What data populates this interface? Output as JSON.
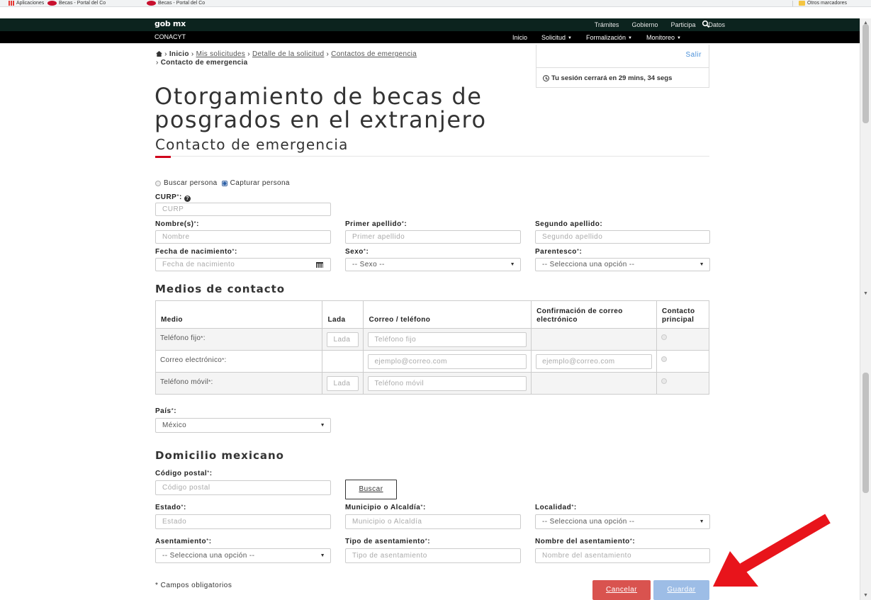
{
  "browser": {
    "bookmarks": [
      {
        "label": "Aplicaciones",
        "icon": "apps-icon"
      },
      {
        "label": "Becas - Portal del Co",
        "icon": "conacyt-favicon"
      },
      {
        "label": "Becas - Portal del Co",
        "icon": "conacyt-favicon"
      }
    ],
    "other_bookmarks": "Otros marcadores"
  },
  "topnav": {
    "brand": "gob mx",
    "links": [
      "Trámites",
      "Gobierno",
      "Participa",
      "Datos"
    ],
    "search_icon": "search-icon"
  },
  "subnav": {
    "org": "CONACYT",
    "links": [
      {
        "label": "Inicio",
        "dropdown": false
      },
      {
        "label": "Solicitud",
        "dropdown": true
      },
      {
        "label": "Formalización",
        "dropdown": true
      },
      {
        "label": "Monitoreo",
        "dropdown": true
      }
    ]
  },
  "breadcrumb": {
    "home": "Inicio",
    "items": [
      "Mis solicitudes",
      "Detalle de la solicitud",
      "Contactos de emergencia"
    ],
    "current": "Contacto de emergencia"
  },
  "session": {
    "logout": "Salir",
    "timer": "Tu sesión cerrará en 29 mins, 34 segs"
  },
  "page": {
    "title_line1": "Otorgamiento de becas de",
    "title_line2": "posgrados en el extranjero",
    "section": "Contacto de emergencia"
  },
  "search_mode": {
    "options": [
      "Buscar persona",
      "Capturar persona"
    ],
    "selected": "Capturar persona"
  },
  "form": {
    "curp": {
      "label": "CURP",
      "placeholder": "CURP"
    },
    "nombre": {
      "label": "Nombre(s)",
      "placeholder": "Nombre"
    },
    "primer_apellido": {
      "label": "Primer apellido",
      "placeholder": "Primer apellido"
    },
    "segundo_apellido": {
      "label": "Segundo apellido:",
      "placeholder": "Segundo apellido"
    },
    "fecha": {
      "label": "Fecha de nacimiento",
      "placeholder": "Fecha de nacimiento"
    },
    "sexo": {
      "label": "Sexo",
      "value": "-- Sexo --"
    },
    "parentesco": {
      "label": "Parentesco",
      "value": "-- Selecciona una opción --"
    }
  },
  "contact_media": {
    "heading": "Medios de contacto",
    "headers": [
      "Medio",
      "Lada",
      "Correo / teléfono",
      "Confirmación de correo electrónico",
      "Contacto principal"
    ],
    "rows": [
      {
        "medio": "Teléfono fijo",
        "lada": "Lada",
        "valor": "Teléfono fijo",
        "confirmacion": ""
      },
      {
        "medio": "Correo electrónico",
        "lada": "",
        "valor": "ejemplo@correo.com",
        "confirmacion": "ejemplo@correo.com"
      },
      {
        "medio": "Teléfono móvil",
        "lada": "Lada",
        "valor": "Teléfono móvil",
        "confirmacion": ""
      }
    ]
  },
  "pais": {
    "label": "País",
    "value": "México"
  },
  "domicilio": {
    "heading": "Domicilio mexicano",
    "cp": {
      "label": "Código postal",
      "placeholder": "Código postal"
    },
    "buscar": "Buscar",
    "estado": {
      "label": "Estado",
      "placeholder": "Estado"
    },
    "municipio": {
      "label": "Municipio o Alcaldía",
      "placeholder": "Municipio o Alcaldía"
    },
    "localidad": {
      "label": "Localidad",
      "value": "-- Selecciona una opción --"
    },
    "asentamiento": {
      "label": "Asentamiento",
      "value": "-- Selecciona una opción --"
    },
    "tipo": {
      "label": "Tipo de asentamiento",
      "placeholder": "Tipo de asentamiento"
    },
    "nombre_asentamiento": {
      "label": "Nombre del asentamiento",
      "placeholder": "Nombre del asentamiento"
    }
  },
  "footer": {
    "required_note": "* Campos obligatorios",
    "cancel": "Cancelar",
    "save": "Guardar"
  },
  "colors": {
    "navbar": "#0c231e",
    "accent_red": "#d0021b",
    "cancel_button": "#d9534f",
    "save_button": "#9dbde6",
    "link": "#4a90d9",
    "annotation_arrow": "#e8141b"
  }
}
